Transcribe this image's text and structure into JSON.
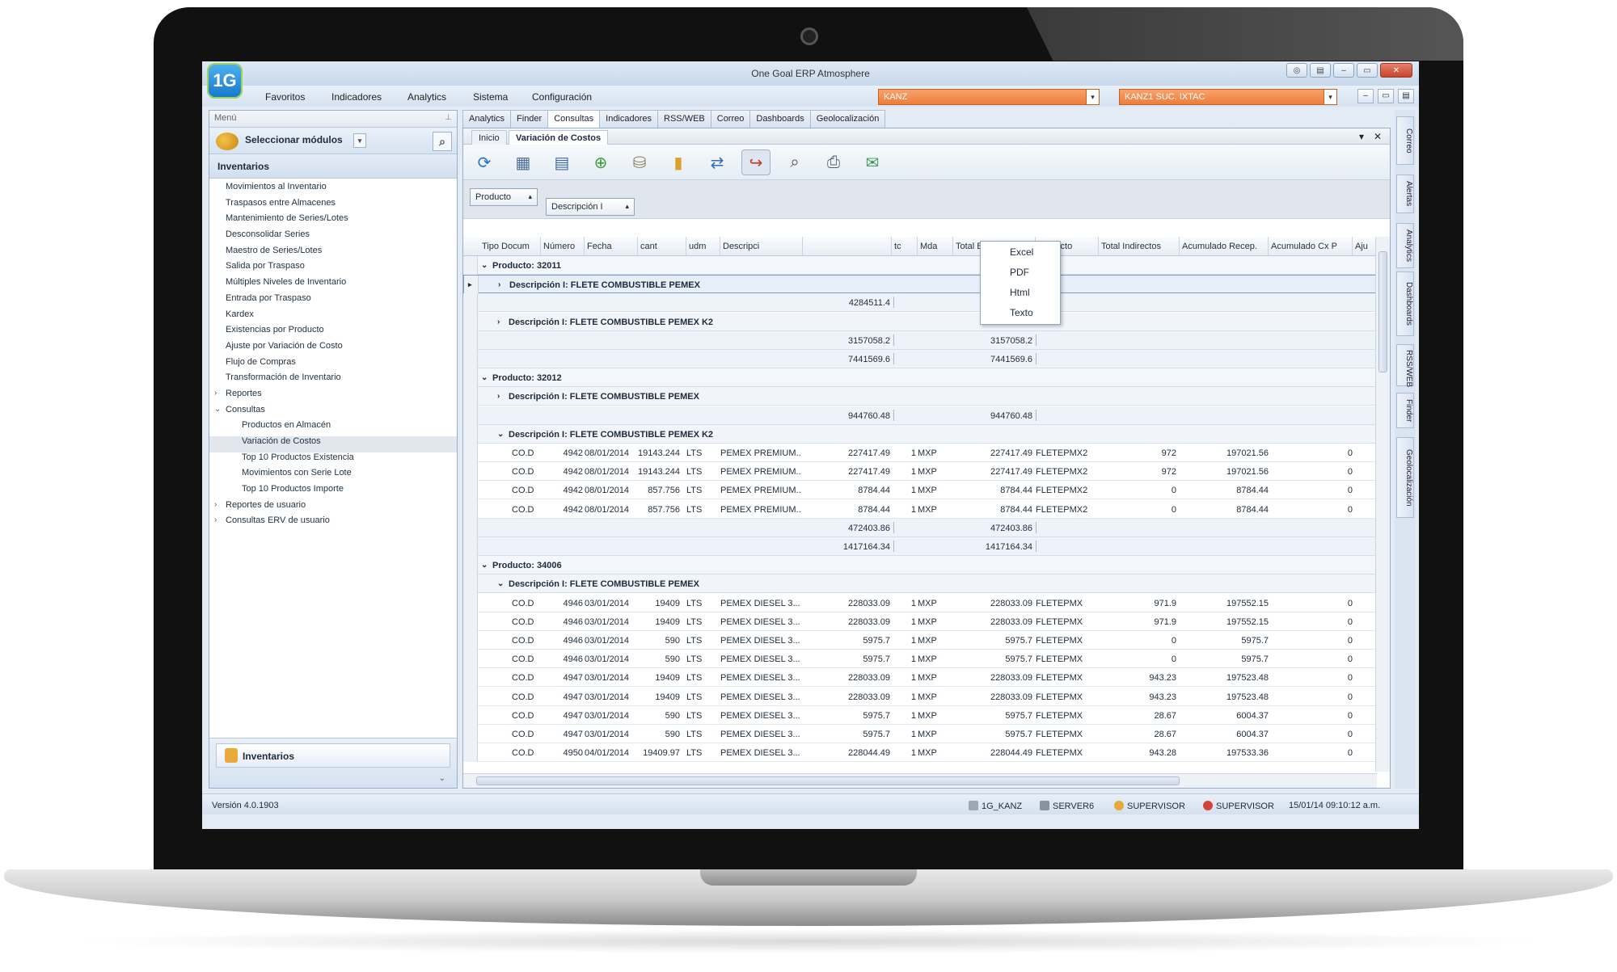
{
  "window": {
    "title": "One Goal ERP Atmosphere",
    "logo": "1G",
    "buttons": [
      "◎",
      "▤",
      "–",
      "▭",
      "✕"
    ]
  },
  "menubar": {
    "items": [
      "Favoritos",
      "Indicadores",
      "Analytics",
      "Sistema",
      "Configuración"
    ],
    "company": "KANZ",
    "branch": "KANZ1 SUC. IXTAC",
    "combo_arrow": "▾",
    "small_buttons": [
      "–",
      "▭",
      "▤"
    ]
  },
  "left_panel": {
    "header": "Menú",
    "pin": "⊥",
    "select_modules": "Seleccionar módulos",
    "dropdown": "▾",
    "search": "⌕",
    "section": "Inventarios",
    "tree": [
      {
        "label": "Movimientos al Inventario",
        "level": 1
      },
      {
        "label": "Traspasos entre Almacenes",
        "level": 1
      },
      {
        "label": "Mantenimiento de Series/Lotes",
        "level": 1
      },
      {
        "label": "Desconsolidar Series",
        "level": 1
      },
      {
        "label": "Maestro de Series/Lotes",
        "level": 1
      },
      {
        "label": "Salida por Traspaso",
        "level": 1
      },
      {
        "label": "Múltiples Niveles de Inventario",
        "level": 1
      },
      {
        "label": "Entrada por Traspaso",
        "level": 1
      },
      {
        "label": "Kardex",
        "level": 1
      },
      {
        "label": "Existencias por Producto",
        "level": 1
      },
      {
        "label": "Ajuste por Variación de Costo",
        "level": 1
      },
      {
        "label": "Flujo de Compras",
        "level": 1
      },
      {
        "label": "Transformación de Inventario",
        "level": 1
      },
      {
        "label": "Reportes",
        "level": 0,
        "expander": "›"
      },
      {
        "label": "Consultas",
        "level": 0,
        "expander": "⌄"
      },
      {
        "label": "Productos en Almacén",
        "level": 2
      },
      {
        "label": "Variación de Costos",
        "level": 2,
        "selected": true
      },
      {
        "label": "Top 10 Productos Existencia",
        "level": 2
      },
      {
        "label": "Movimientos con Serie Lote",
        "level": 2
      },
      {
        "label": "Top 10 Productos Importe",
        "level": 2
      },
      {
        "label": "Reportes de usuario",
        "level": 0,
        "expander": "›"
      },
      {
        "label": "Consultas ERV de usuario",
        "level": 0,
        "expander": "›"
      }
    ],
    "footer_module": "Inventarios",
    "footer_chevron": "⌄"
  },
  "tabs": [
    "Analytics",
    "Finder",
    "Consultas",
    "Indicadores",
    "RSS/WEB",
    "Correo",
    "Dashboards",
    "Geolocalización"
  ],
  "active_tab": "Consultas",
  "subtabs": {
    "inicio": "Inicio",
    "active": "Variación de Costos",
    "menu": "▾",
    "close": "✕"
  },
  "toolbar": {
    "icons": [
      "refresh-icon",
      "layout-icon",
      "columns-icon",
      "add-icon",
      "database-icon",
      "folder-icon",
      "swap-icon",
      "export-icon",
      "preview-icon",
      "print-icon",
      "email-icon"
    ],
    "glyphs": [
      "⟳",
      "▦",
      "▤",
      "⊕",
      "⛁",
      "▮",
      "⇄",
      "↪",
      "⌕",
      "⎙",
      "✉"
    ]
  },
  "export_menu": [
    "Excel",
    "PDF",
    "Html",
    "Texto"
  ],
  "group_by": [
    {
      "label": "Producto",
      "sort": "▴"
    },
    {
      "label": "Descripción I",
      "sort": "▴"
    }
  ],
  "columns": [
    "Tipo Docum",
    "Número",
    "Fecha",
    "cant",
    "udm",
    "Descripci",
    "",
    "tc",
    "Mda",
    "Total Base Prod",
    "Indirecto",
    "Total Indirectos",
    "Acumulado Recep.",
    "Acumulado Cx P",
    "Aju"
  ],
  "rows": [
    {
      "kind": "group1",
      "expander": "⌄",
      "text": "Producto: 32011"
    },
    {
      "kind": "group2",
      "expander": "›",
      "text": "Descripción I: FLETE COMBUSTIBLE PEMEX",
      "selected": true,
      "indicator": "▸"
    },
    {
      "kind": "sum",
      "a": "4284511.4",
      "b": "4284511.4"
    },
    {
      "kind": "group2",
      "expander": "›",
      "text": "Descripción I: FLETE COMBUSTIBLE PEMEX K2"
    },
    {
      "kind": "sum",
      "a": "3157058.2",
      "b": "3157058.2"
    },
    {
      "kind": "sum",
      "a": "7441569.6",
      "b": "7441569.6"
    },
    {
      "kind": "group1",
      "expander": "⌄",
      "text": "Producto: 32012"
    },
    {
      "kind": "group2",
      "expander": "›",
      "text": "Descripción I: FLETE COMBUSTIBLE PEMEX"
    },
    {
      "kind": "sum",
      "a": "944760.48",
      "b": "944760.48"
    },
    {
      "kind": "group2",
      "expander": "⌄",
      "text": "Descripción I: FLETE COMBUSTIBLE PEMEX K2"
    },
    {
      "kind": "data",
      "cells": [
        "CO.D",
        "4942",
        "08/01/2014",
        "19143.244",
        "LTS",
        "PEMEX PREMIUM...",
        "227417.49",
        "1",
        "MXP",
        "227417.49",
        "FLETEPMX2",
        "972",
        "197021.56",
        "0"
      ]
    },
    {
      "kind": "data",
      "cells": [
        "CO.D",
        "4942",
        "08/01/2014",
        "19143.244",
        "LTS",
        "PEMEX PREMIUM...",
        "227417.49",
        "1",
        "MXP",
        "227417.49",
        "FLETEPMX2",
        "972",
        "197021.56",
        "0"
      ]
    },
    {
      "kind": "data",
      "cells": [
        "CO.D",
        "4942",
        "08/01/2014",
        "857.756",
        "LTS",
        "PEMEX PREMIUM...",
        "8784.44",
        "1",
        "MXP",
        "8784.44",
        "FLETEPMX2",
        "0",
        "8784.44",
        "0"
      ]
    },
    {
      "kind": "data",
      "cells": [
        "CO.D",
        "4942",
        "08/01/2014",
        "857.756",
        "LTS",
        "PEMEX PREMIUM...",
        "8784.44",
        "1",
        "MXP",
        "8784.44",
        "FLETEPMX2",
        "0",
        "8784.44",
        "0"
      ]
    },
    {
      "kind": "sum",
      "a": "472403.86",
      "b": "472403.86"
    },
    {
      "kind": "sum",
      "a": "1417164.34",
      "b": "1417164.34"
    },
    {
      "kind": "group1",
      "expander": "⌄",
      "text": "Producto: 34006"
    },
    {
      "kind": "group2",
      "expander": "⌄",
      "text": "Descripción I: FLETE COMBUSTIBLE PEMEX"
    },
    {
      "kind": "data",
      "cells": [
        "CO.D",
        "4946",
        "03/01/2014",
        "19409",
        "LTS",
        "PEMEX DIESEL 3...",
        "228033.09",
        "1",
        "MXP",
        "228033.09",
        "FLETEPMX",
        "971.9",
        "197552.15",
        "0"
      ]
    },
    {
      "kind": "data",
      "cells": [
        "CO.D",
        "4946",
        "03/01/2014",
        "19409",
        "LTS",
        "PEMEX DIESEL 3...",
        "228033.09",
        "1",
        "MXP",
        "228033.09",
        "FLETEPMX",
        "971.9",
        "197552.15",
        "0"
      ]
    },
    {
      "kind": "data",
      "cells": [
        "CO.D",
        "4946",
        "03/01/2014",
        "590",
        "LTS",
        "PEMEX DIESEL 3...",
        "5975.7",
        "1",
        "MXP",
        "5975.7",
        "FLETEPMX",
        "0",
        "5975.7",
        "0"
      ]
    },
    {
      "kind": "data",
      "cells": [
        "CO.D",
        "4946",
        "03/01/2014",
        "590",
        "LTS",
        "PEMEX DIESEL 3...",
        "5975.7",
        "1",
        "MXP",
        "5975.7",
        "FLETEPMX",
        "0",
        "5975.7",
        "0"
      ]
    },
    {
      "kind": "data",
      "cells": [
        "CO.D",
        "4947",
        "03/01/2014",
        "19409",
        "LTS",
        "PEMEX DIESEL 3...",
        "228033.09",
        "1",
        "MXP",
        "228033.09",
        "FLETEPMX",
        "943.23",
        "197523.48",
        "0"
      ]
    },
    {
      "kind": "data",
      "cells": [
        "CO.D",
        "4947",
        "03/01/2014",
        "19409",
        "LTS",
        "PEMEX DIESEL 3...",
        "228033.09",
        "1",
        "MXP",
        "228033.09",
        "FLETEPMX",
        "943.23",
        "197523.48",
        "0"
      ]
    },
    {
      "kind": "data",
      "cells": [
        "CO.D",
        "4947",
        "03/01/2014",
        "590",
        "LTS",
        "PEMEX DIESEL 3...",
        "5975.7",
        "1",
        "MXP",
        "5975.7",
        "FLETEPMX",
        "28.67",
        "6004.37",
        "0"
      ]
    },
    {
      "kind": "data",
      "cells": [
        "CO.D",
        "4947",
        "03/01/2014",
        "590",
        "LTS",
        "PEMEX DIESEL 3...",
        "5975.7",
        "1",
        "MXP",
        "5975.7",
        "FLETEPMX",
        "28.67",
        "6004.37",
        "0"
      ]
    },
    {
      "kind": "data",
      "cells": [
        "CO.D",
        "4950",
        "04/01/2014",
        "19409.97",
        "LTS",
        "PEMEX DIESEL 3...",
        "228044.49",
        "1",
        "MXP",
        "228044.49",
        "FLETEPMX",
        "943.28",
        "197533.36",
        "0"
      ]
    }
  ],
  "right_tabs": [
    "Correo",
    "Alertas",
    "Analytics",
    "Dashboards",
    "RSS/WEB",
    "Finder",
    "Geolocalización"
  ],
  "status": {
    "version": "Versión 4.0.1903",
    "user_db": "1G_KANZ",
    "server": "SERVER6",
    "user1": "SUPERVISOR",
    "user2": "SUPERVISOR",
    "datetime": "15/01/14 09:10:12 a.m."
  },
  "colors": {
    "accent_orange": "#ee7d3c",
    "frame_blue": "#98aecb",
    "selected_row": "#e6eef8"
  }
}
